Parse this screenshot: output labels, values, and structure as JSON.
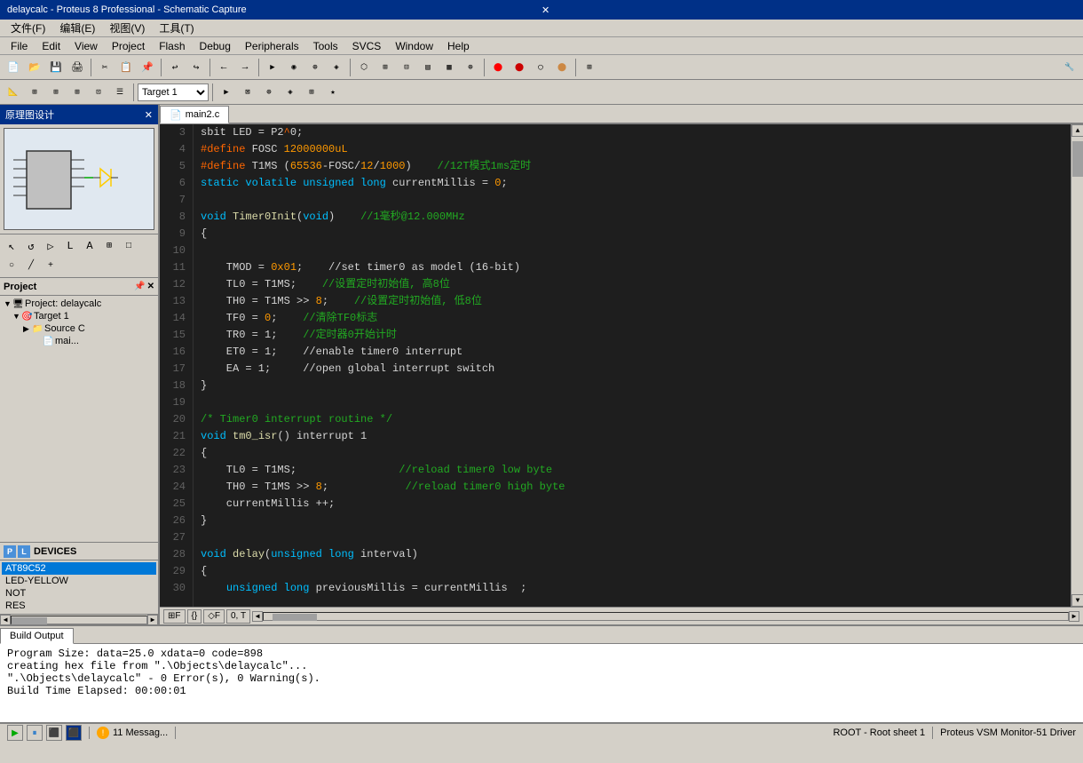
{
  "titleBar": {
    "text": "delaycalc - Proteus 8 Professional - Schematic Capture",
    "closeBtn": "✕"
  },
  "chineseMenuBar": {
    "items": [
      "文件(F)",
      "编辑(E)",
      "视图(V)",
      "工具(T)"
    ]
  },
  "menuBar": {
    "items": [
      "File",
      "Edit",
      "View",
      "Project",
      "Flash",
      "Debug",
      "Peripherals",
      "Tools",
      "SVCS",
      "Window",
      "Help"
    ]
  },
  "toolbar1": {
    "target": "Target 1"
  },
  "schematic": {
    "title": "原理图设计",
    "closeBtn": "✕"
  },
  "project": {
    "title": "Project",
    "items": [
      {
        "label": "Project: delaycalc",
        "level": 0,
        "icon": "📁",
        "expand": "▼"
      },
      {
        "label": "Target 1",
        "level": 1,
        "icon": "🎯",
        "expand": "▼"
      },
      {
        "label": "Source C",
        "level": 2,
        "icon": "📁",
        "expand": "▶"
      },
      {
        "label": "mai...",
        "level": 3,
        "icon": "📄",
        "expand": ""
      }
    ]
  },
  "devices": {
    "title": "DEVICES",
    "tabs": [
      "P",
      "L"
    ],
    "items": [
      {
        "label": "AT89C52",
        "selected": true
      },
      {
        "label": "LED-YELLOW",
        "selected": false
      },
      {
        "label": "NOT",
        "selected": false
      },
      {
        "label": "RES",
        "selected": false
      }
    ]
  },
  "codeTab": {
    "filename": "main2.c",
    "icon": "📄"
  },
  "code": {
    "lines": [
      {
        "num": "3",
        "content": "<w>sbit LED = P2</w><c2>^</c2><w>0;</w>"
      },
      {
        "num": "4",
        "content": "<pp>#define</pp> <w>FOSC</w> <sp>12000000uL</sp>"
      },
      {
        "num": "5",
        "content": "<pp>#define</pp> <w>T1MS</w> <sp>(65536-FOSC/12/1000)</sp>    <cm>//12T模式1ms定时</cm>"
      },
      {
        "num": "6",
        "content": "<kw>static</kw> <kw>volatile</kw> <kw>unsigned</kw> <kw>long</kw> <w>currentMillis = 0;</w>"
      },
      {
        "num": "7",
        "content": ""
      },
      {
        "num": "8",
        "content": "<kw>void</kw> <fn>Timer0Init</fn><w>(void)    //1毫秒@12.000MHz</w>"
      },
      {
        "num": "9",
        "content": "<w>{</w>"
      },
      {
        "num": "10",
        "content": ""
      },
      {
        "num": "11",
        "content": "    <w>TMOD = </w><sp>0x01</sp><w>;    //set timer0 </w><w>as</w><w> mode1 (16-bit)</w>"
      },
      {
        "num": "12",
        "content": "    <w>TL0 = T1MS;    </w><cm>//设置定时初始值, 高8位</cm>"
      },
      {
        "num": "13",
        "content": "    <w>TH0 = T1MS >> 8;    </w><cm>//设置定时初始值, 低8位</cm>"
      },
      {
        "num": "14",
        "content": "    <w>TF0 = </w><sp>0</sp><w>;    </w><cm>//清除TF0标志</cm>"
      },
      {
        "num": "15",
        "content": "    <w>TR0 = 1;    </w><cm>//定时器0开始计时</cm>"
      },
      {
        "num": "16",
        "content": "    <w>ET0 = 1;    //enable timer0 interrupt</w>"
      },
      {
        "num": "17",
        "content": "    <w>EA = 1;     //open global interrupt switch</w>"
      },
      {
        "num": "18",
        "content": "<w>}</w>"
      },
      {
        "num": "19",
        "content": ""
      },
      {
        "num": "20",
        "content": "<cm>/* Timer0 interrupt routine */</cm>"
      },
      {
        "num": "21",
        "content": "<kw>void</kw> <fn>tm0_isr</fn><w>() interrupt 1</w>"
      },
      {
        "num": "22",
        "content": "<w>{</w>"
      },
      {
        "num": "23",
        "content": "    <w>TL0 = T1MS;                </w><cm>//reload timer0 low byte</cm>"
      },
      {
        "num": "24",
        "content": "    <w>TH0 = T1MS >> </w><sp>8</sp><w>;            </w><cm>//reload timer0 high byte</cm>"
      },
      {
        "num": "25",
        "content": "    <w>currentMillis ++;</w>"
      },
      {
        "num": "26",
        "content": "<w>}</w>"
      },
      {
        "num": "27",
        "content": ""
      },
      {
        "num": "28",
        "content": "<kw>void</kw> <fn>delay</fn><w>(</w><kw>unsigned long</kw><w> interval)</w>"
      },
      {
        "num": "29",
        "content": "<w>{</w>"
      },
      {
        "num": "30",
        "content": "    <kw>unsigned long</kw> <w>previousMillis = currentMillis  ;</w>"
      }
    ]
  },
  "buildOutput": {
    "title": "Build Output",
    "lines": [
      "Program Size: data=25.0 xdata=0 code=898",
      "creating hex file from \".\\Objects\\delaycalc\"...",
      "\".\\Objects\\delaycalc\" - 0 Error(s), 0 Warning(s).",
      "Build Time Elapsed:  00:00:01"
    ]
  },
  "statusBar": {
    "messages": "11 Messag...",
    "root": "ROOT - Root sheet 1"
  },
  "bottomTabs": {
    "items": [
      "⊞F",
      "{}",
      "◇F",
      "0, T"
    ]
  },
  "vsm": {
    "text": "Proteus VSM Monitor-51 Driver"
  }
}
